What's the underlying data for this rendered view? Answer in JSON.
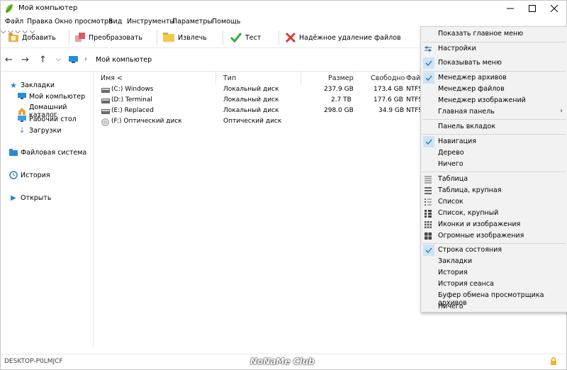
{
  "window": {
    "title": "Мой компьютер"
  },
  "menubar": [
    "Файл",
    "Правка",
    "Окно просмотра",
    "Вид",
    "Инструменты",
    "Параметры",
    "Помощь"
  ],
  "toolbar": {
    "add": "Добавить",
    "convert": "Преобразовать",
    "extract": "Извлечь",
    "test": "Тест",
    "wipe": "Надёжное удаление файлов"
  },
  "address": {
    "path": "Мой компьютер"
  },
  "sidebar": {
    "bookmarks": "Закладки",
    "items": [
      "Мой компьютер",
      "Домашний каталог",
      "Рабочий стол",
      "Загрузки"
    ],
    "filesystem": "Файловая система",
    "history": "История",
    "open": "Открыть"
  },
  "columns": {
    "name": "Имя <",
    "type": "Тип",
    "size": "Размер",
    "free": "Свободно",
    "fs": "Файл"
  },
  "rows": [
    {
      "name": "(C:) Windows",
      "type": "Локальный диск",
      "size": "237.9 GB",
      "free": "173.4 GB",
      "fs": "NTFS"
    },
    {
      "name": "(D:) Terminal",
      "type": "Локальный диск",
      "size": "2.7 TB",
      "free": "177.6 GB",
      "fs": "NTFS"
    },
    {
      "name": "(E:) Replaced",
      "type": "Локальный диск",
      "size": "298.0 GB",
      "free": "34.9 GB",
      "fs": "NTFS"
    },
    {
      "name": "(F:) Оптический диск",
      "type": "Оптический диск",
      "size": "",
      "free": "",
      "fs": ""
    }
  ],
  "status": {
    "computer": "DESKTOP-P0LMJCF",
    "watermark": "NoNaMe Club"
  },
  "context_menu": {
    "show_main_menu": "Показать главное меню",
    "settings": "Настройки",
    "show_menu": "Показывать меню",
    "archive_manager": "Менеджер архивов",
    "file_manager": "Менеджер файлов",
    "image_manager": "Менеджер изображений",
    "main_panel": "Главная панель",
    "tabs_panel": "Панель вкладок",
    "navigation": "Навигация",
    "tree": "Дерево",
    "nothing1": "Ничего",
    "table": "Таблица",
    "table_large": "Таблица, крупная",
    "list": "Список",
    "list_large": "Список, крупный",
    "icons_images": "Иконки и изображения",
    "huge_images": "Огромные изображения",
    "status_bar": "Строка состояния",
    "bookmarks": "Закладки",
    "history": "История",
    "session_history": "История сеанса",
    "clipboard": "Буфер обмена просмотрщика архивов",
    "nothing2": "Ничего"
  },
  "colors": {
    "accent": "#0078d7",
    "check_bg": "#cde4f7",
    "folder": "#e8b84a"
  }
}
